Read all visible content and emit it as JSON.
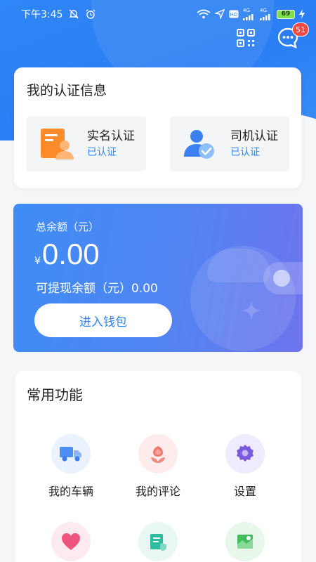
{
  "status_bar": {
    "time": "下午3:45",
    "battery": "69",
    "signal_1_label": "4G",
    "signal_2_label": "4G"
  },
  "header": {
    "message_badge": "51"
  },
  "certification": {
    "title": "我的认证信息",
    "items": [
      {
        "name": "实名认证",
        "status": "已认证",
        "icon": "id-card-icon"
      },
      {
        "name": "司机认证",
        "status": "已认证",
        "icon": "driver-verified-icon"
      }
    ]
  },
  "wallet": {
    "balance_label": "总余额（元）",
    "currency": "¥",
    "balance": "0.00",
    "withdrawable_label": "可提现余额（元）0.00",
    "enter_button": "进入钱包"
  },
  "functions": {
    "title": "常用功能",
    "items": [
      {
        "label": "我的车辆",
        "icon": "truck-icon"
      },
      {
        "label": "我的评论",
        "icon": "flower-icon"
      },
      {
        "label": "设置",
        "icon": "gear-icon"
      },
      {
        "label": "",
        "icon": "heart-icon"
      },
      {
        "label": "",
        "icon": "document-check-icon"
      },
      {
        "label": "",
        "icon": "map-icon"
      }
    ]
  },
  "colors": {
    "accent": "#2f86f6",
    "badge": "#f24a41"
  }
}
